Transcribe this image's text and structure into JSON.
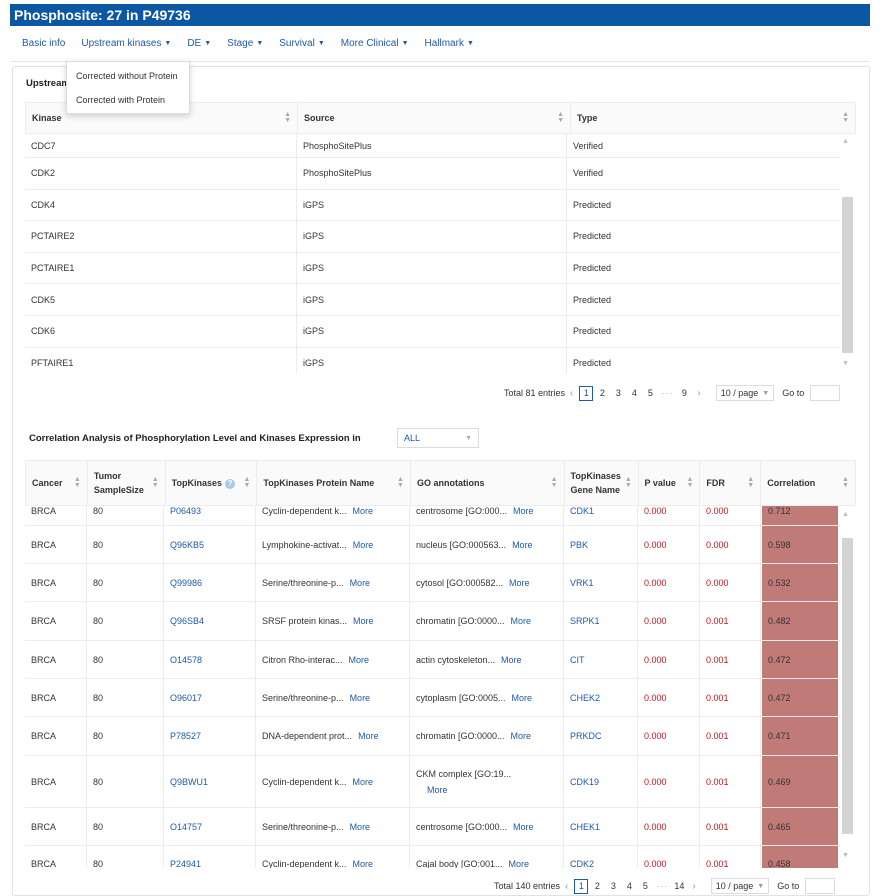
{
  "title": "Phosphosite: 27 in P49736",
  "nav": [
    {
      "label": "Basic info",
      "has_dropdown": false
    },
    {
      "label": "Upstream kinases",
      "has_dropdown": true
    },
    {
      "label": "DE",
      "has_dropdown": true
    },
    {
      "label": "Stage",
      "has_dropdown": true
    },
    {
      "label": "Survival",
      "has_dropdown": true
    },
    {
      "label": "More Clinical",
      "has_dropdown": true
    },
    {
      "label": "Hallmark",
      "has_dropdown": true
    }
  ],
  "dropdown": {
    "items": [
      "Corrected without Protein",
      "Corrected with Protein"
    ]
  },
  "upstream": {
    "section_title": "Upstream",
    "columns": [
      "Kinase",
      "Source",
      "Type"
    ],
    "rows": [
      [
        "CDC7",
        "PhosphoSitePlus",
        "Verified"
      ],
      [
        "CDK2",
        "PhosphoSitePlus",
        "Verified"
      ],
      [
        "CDK4",
        "iGPS",
        "Predicted"
      ],
      [
        "PCTAIRE2",
        "iGPS",
        "Predicted"
      ],
      [
        "PCTAIRE1",
        "iGPS",
        "Predicted"
      ],
      [
        "CDK5",
        "iGPS",
        "Predicted"
      ],
      [
        "CDK6",
        "iGPS",
        "Predicted"
      ],
      [
        "PFTAIRE1",
        "iGPS",
        "Predicted"
      ]
    ],
    "pagination": {
      "total": "Total 81 entries",
      "pages": [
        "1",
        "2",
        "3",
        "4",
        "5"
      ],
      "ellipsis": "···",
      "last": "9",
      "page_size": "10 / page",
      "goto_label": "Go to"
    }
  },
  "correlation": {
    "title": "Correlation Analysis of Phosphorylation Level and Kinases Expression in",
    "filter": "ALL",
    "columns": {
      "cancer": "Cancer",
      "tumor_line1": "Tumor",
      "tumor_line2": "SampleSize",
      "topkinases": "TopKinases",
      "protein_name": "TopKinases Protein Name",
      "go": "GO annotations",
      "gene_line1": "TopKinases",
      "gene_line2": "Gene Name",
      "pvalue": "P value",
      "fdr": "FDR",
      "correlation": "Correlation"
    },
    "more_label": "More",
    "rows": [
      {
        "cancer": "BRCA",
        "size": "80",
        "kinase": "P06493",
        "protein": "Cyclin-dependent k...",
        "go": "centrosome [GO:000...",
        "gene": "CDK1",
        "p": "0.000",
        "fdr": "0.000",
        "corr": "0.712"
      },
      {
        "cancer": "BRCA",
        "size": "80",
        "kinase": "Q96KB5",
        "protein": "Lymphokine-activat...",
        "go": "nucleus [GO:000563...",
        "gene": "PBK",
        "p": "0.000",
        "fdr": "0.000",
        "corr": "0.598"
      },
      {
        "cancer": "BRCA",
        "size": "80",
        "kinase": "Q99986",
        "protein": "Serine/threonine-p...",
        "go": "cytosol [GO:000582...",
        "gene": "VRK1",
        "p": "0.000",
        "fdr": "0.000",
        "corr": "0.532"
      },
      {
        "cancer": "BRCA",
        "size": "80",
        "kinase": "Q96SB4",
        "protein": "SRSF protein kinas...",
        "go": "chromatin [GO:0000...",
        "gene": "SRPK1",
        "p": "0.000",
        "fdr": "0.001",
        "corr": "0.482"
      },
      {
        "cancer": "BRCA",
        "size": "80",
        "kinase": "O14578",
        "protein": "Citron Rho-interac...",
        "go": "actin cytoskeleton...",
        "gene": "CIT",
        "p": "0.000",
        "fdr": "0.001",
        "corr": "0.472"
      },
      {
        "cancer": "BRCA",
        "size": "80",
        "kinase": "O96017",
        "protein": "Serine/threonine-p...",
        "go": "cytoplasm [GO:0005...",
        "gene": "CHEK2",
        "p": "0.000",
        "fdr": "0.001",
        "corr": "0.472"
      },
      {
        "cancer": "BRCA",
        "size": "80",
        "kinase": "P78527",
        "protein": "DNA-dependent prot...",
        "go": "chromatin [GO:0000...",
        "gene": "PRKDC",
        "p": "0.000",
        "fdr": "0.001",
        "corr": "0.471"
      },
      {
        "cancer": "BRCA",
        "size": "80",
        "kinase": "Q9BWU1",
        "protein": "Cyclin-dependent k...",
        "go": "CKM complex [GO:19...",
        "gene": "CDK19",
        "p": "0.000",
        "fdr": "0.001",
        "corr": "0.469"
      },
      {
        "cancer": "BRCA",
        "size": "80",
        "kinase": "O14757",
        "protein": "Serine/threonine-p...",
        "go": "centrosome [GO:000...",
        "gene": "CHEK1",
        "p": "0.000",
        "fdr": "0.001",
        "corr": "0.465"
      },
      {
        "cancer": "BRCA",
        "size": "80",
        "kinase": "P24941",
        "protein": "Cyclin-dependent k...",
        "go": "Cajal body [GO:001...",
        "gene": "CDK2",
        "p": "0.000",
        "fdr": "0.001",
        "corr": "0.458"
      }
    ],
    "pagination": {
      "total": "Total 140 entries",
      "pages": [
        "1",
        "2",
        "3",
        "4",
        "5"
      ],
      "ellipsis": "···",
      "last": "14",
      "page_size": "10 / page",
      "goto_label": "Go to"
    }
  },
  "colors": {
    "title_bar": "#0b57a4",
    "link": "#1f5aa6",
    "red_value": "#c0161d",
    "correlation_fill": "#c07a78"
  }
}
